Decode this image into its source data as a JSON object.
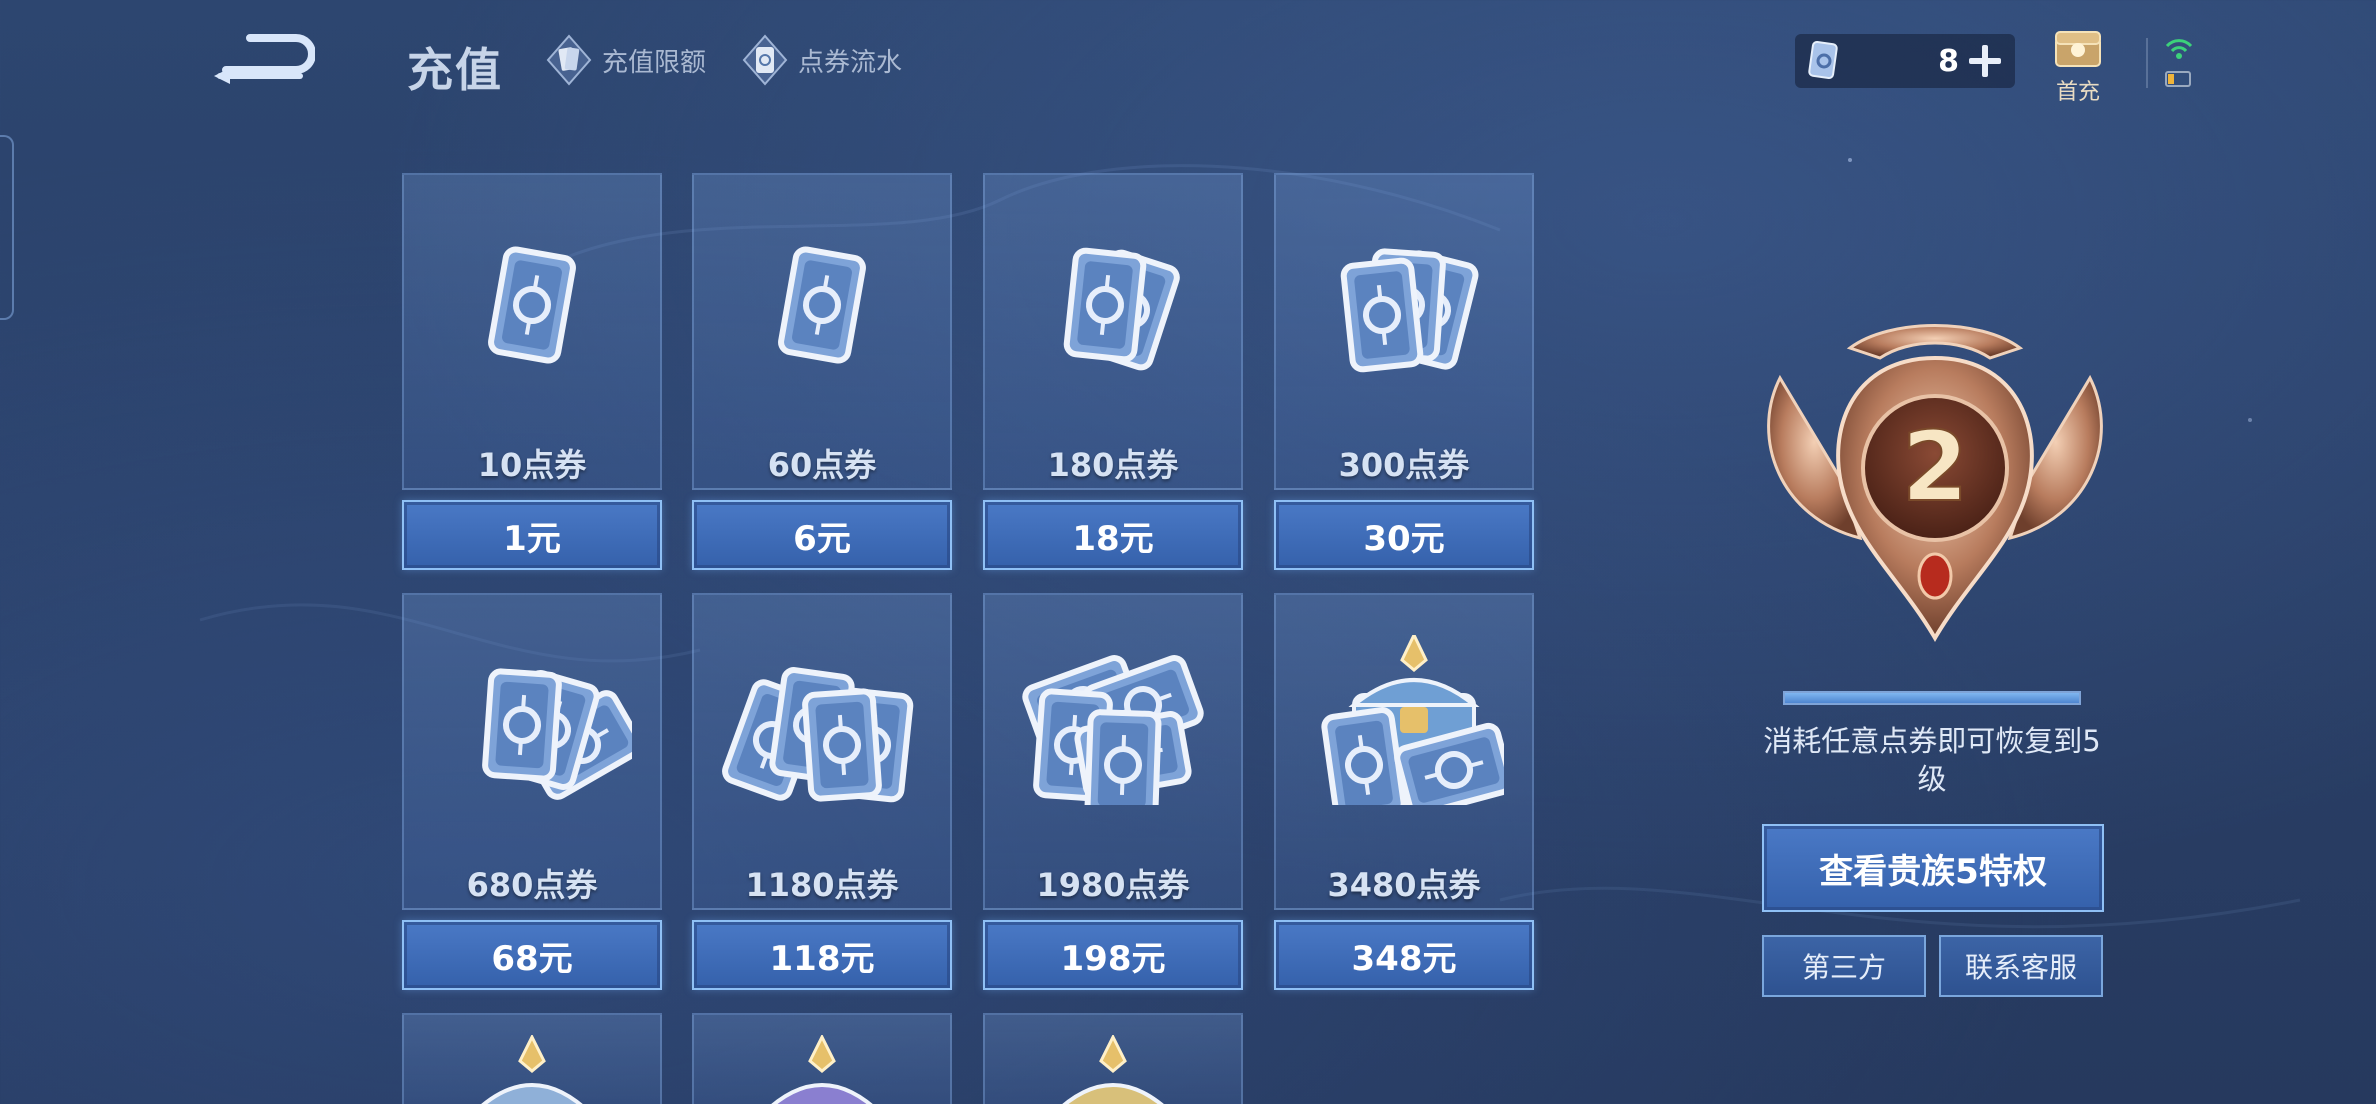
{
  "header": {
    "title": "充值",
    "links": [
      {
        "label": "充值限额"
      },
      {
        "label": "点券流水"
      }
    ],
    "balance": "8",
    "first_charge_label": "首充"
  },
  "packages": [
    {
      "points": "10点券",
      "price": "1元",
      "icon": "coupon-single-icon"
    },
    {
      "points": "60点券",
      "price": "6元",
      "icon": "coupon-single-icon"
    },
    {
      "points": "180点券",
      "price": "18元",
      "icon": "coupon-pair-icon"
    },
    {
      "points": "300点券",
      "price": "30元",
      "icon": "coupon-triple-icon"
    },
    {
      "points": "680点券",
      "price": "68元",
      "icon": "coupon-fan-icon"
    },
    {
      "points": "1180点券",
      "price": "118元",
      "icon": "coupon-spread-icon"
    },
    {
      "points": "1980点券",
      "price": "198元",
      "icon": "coupon-pile-icon"
    },
    {
      "points": "3480点券",
      "price": "348元",
      "icon": "treasure-chest-icon"
    }
  ],
  "more_chests": [
    {
      "icon": "silver-chest-icon"
    },
    {
      "icon": "purple-chest-icon"
    },
    {
      "icon": "gold-chest-icon"
    }
  ],
  "noble": {
    "level": "2",
    "progress": 1.0,
    "restore_text": "消耗任意点券即可恢复到5级",
    "view_button": "查看贵族5特权",
    "third_party_button": "第三方",
    "support_button": "联系客服"
  },
  "colors": {
    "background": "#2a4068",
    "price_button": "#3f6db8",
    "button_border": "#8fc0f5",
    "badge_bronze": "#b87c5e"
  }
}
